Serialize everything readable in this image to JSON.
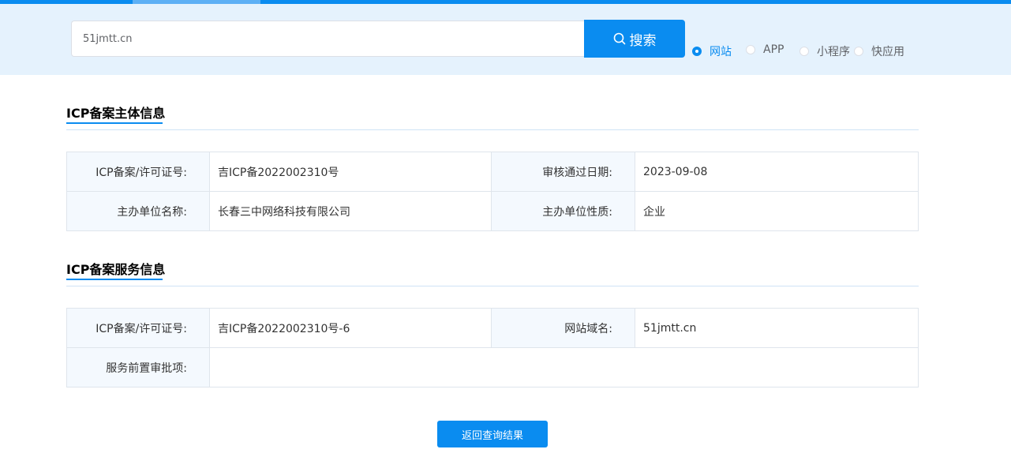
{
  "search": {
    "value": "51jmtt.cn",
    "button_label": "搜索",
    "options": [
      {
        "label": "网站",
        "checked": true
      },
      {
        "label": "APP",
        "checked": false
      },
      {
        "label": "小程序",
        "checked": false
      },
      {
        "label": "快应用",
        "checked": false
      }
    ]
  },
  "subject_section": {
    "title": "ICP备案主体信息",
    "rows": [
      {
        "label1": "ICP备案/许可证号:",
        "value1": "吉ICP备2022002310号",
        "label2": "审核通过日期:",
        "value2": "2023-09-08"
      },
      {
        "label1": "主办单位名称:",
        "value1": "长春三中网络科技有限公司",
        "label2": "主办单位性质:",
        "value2": "企业"
      }
    ]
  },
  "service_section": {
    "title": "ICP备案服务信息",
    "rows": [
      {
        "label1": "ICP备案/许可证号:",
        "value1": "吉ICP备2022002310号-6",
        "label2": "网站域名:",
        "value2": "51jmtt.cn"
      },
      {
        "label1": "服务前置审批项:",
        "value1": ""
      }
    ]
  },
  "back_button_label": "返回查询结果",
  "colors": {
    "accent": "#0a8cf0",
    "band": "#e5f2fd",
    "label_bg": "#f4f9fe",
    "border": "#dfe5ec"
  }
}
